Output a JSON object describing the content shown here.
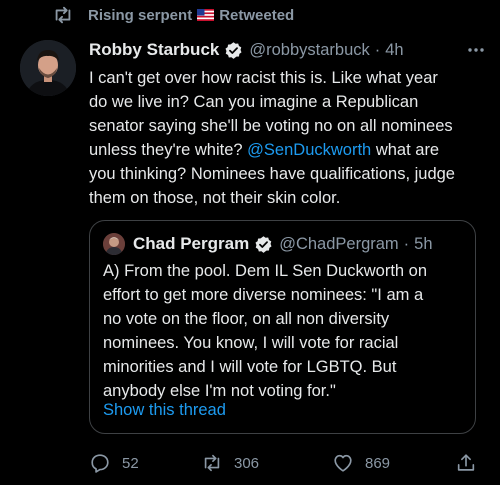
{
  "retweet": {
    "user": "Rising serpent",
    "label": "Retweeted",
    "flag_icon": "us-flag-icon",
    "icon": "retweet-icon"
  },
  "tweet": {
    "author_name": "Robby Starbuck",
    "handle": "@robbystarbuck",
    "separator": "·",
    "time": "4h",
    "verified_icon": "verified-badge-icon",
    "more_icon": "more-options-icon",
    "text_lines": [
      "I can't get over how racist this is. Like what year",
      "do we live in? Can you imagine a Republican",
      "senator saying she'll be voting no on all nominees",
      "unless they're white?",
      "what are",
      "you thinking? Nominees have qualifications, judge",
      "them on those, not their skin color."
    ],
    "mention": "@SenDuckworth"
  },
  "quote": {
    "author_name": "Chad Pergram",
    "handle": "@ChadPergram",
    "separator": "·",
    "time": "5h",
    "text_lines": [
      "A) From the pool. Dem IL Sen Duckworth on",
      "effort to get more diverse nominees: \"I am a",
      "no vote on the floor, on all non diversity",
      "nominees. You know, I will vote for racial",
      "minorities and I will vote for LGBTQ. But",
      "anybody else I'm not voting for.\""
    ],
    "show_thread_label": "Show this thread"
  },
  "actions": {
    "reply_count": "52",
    "retweet_count": "306",
    "like_count": "869",
    "reply_icon": "reply-icon",
    "retweet_icon": "retweet-icon",
    "like_icon": "heart-icon",
    "share_icon": "share-icon"
  },
  "colors": {
    "background": "#000000",
    "text": "#e7e9ea",
    "secondary": "#8b98a5",
    "link": "#1d9bf0",
    "border": "#3e4144"
  }
}
